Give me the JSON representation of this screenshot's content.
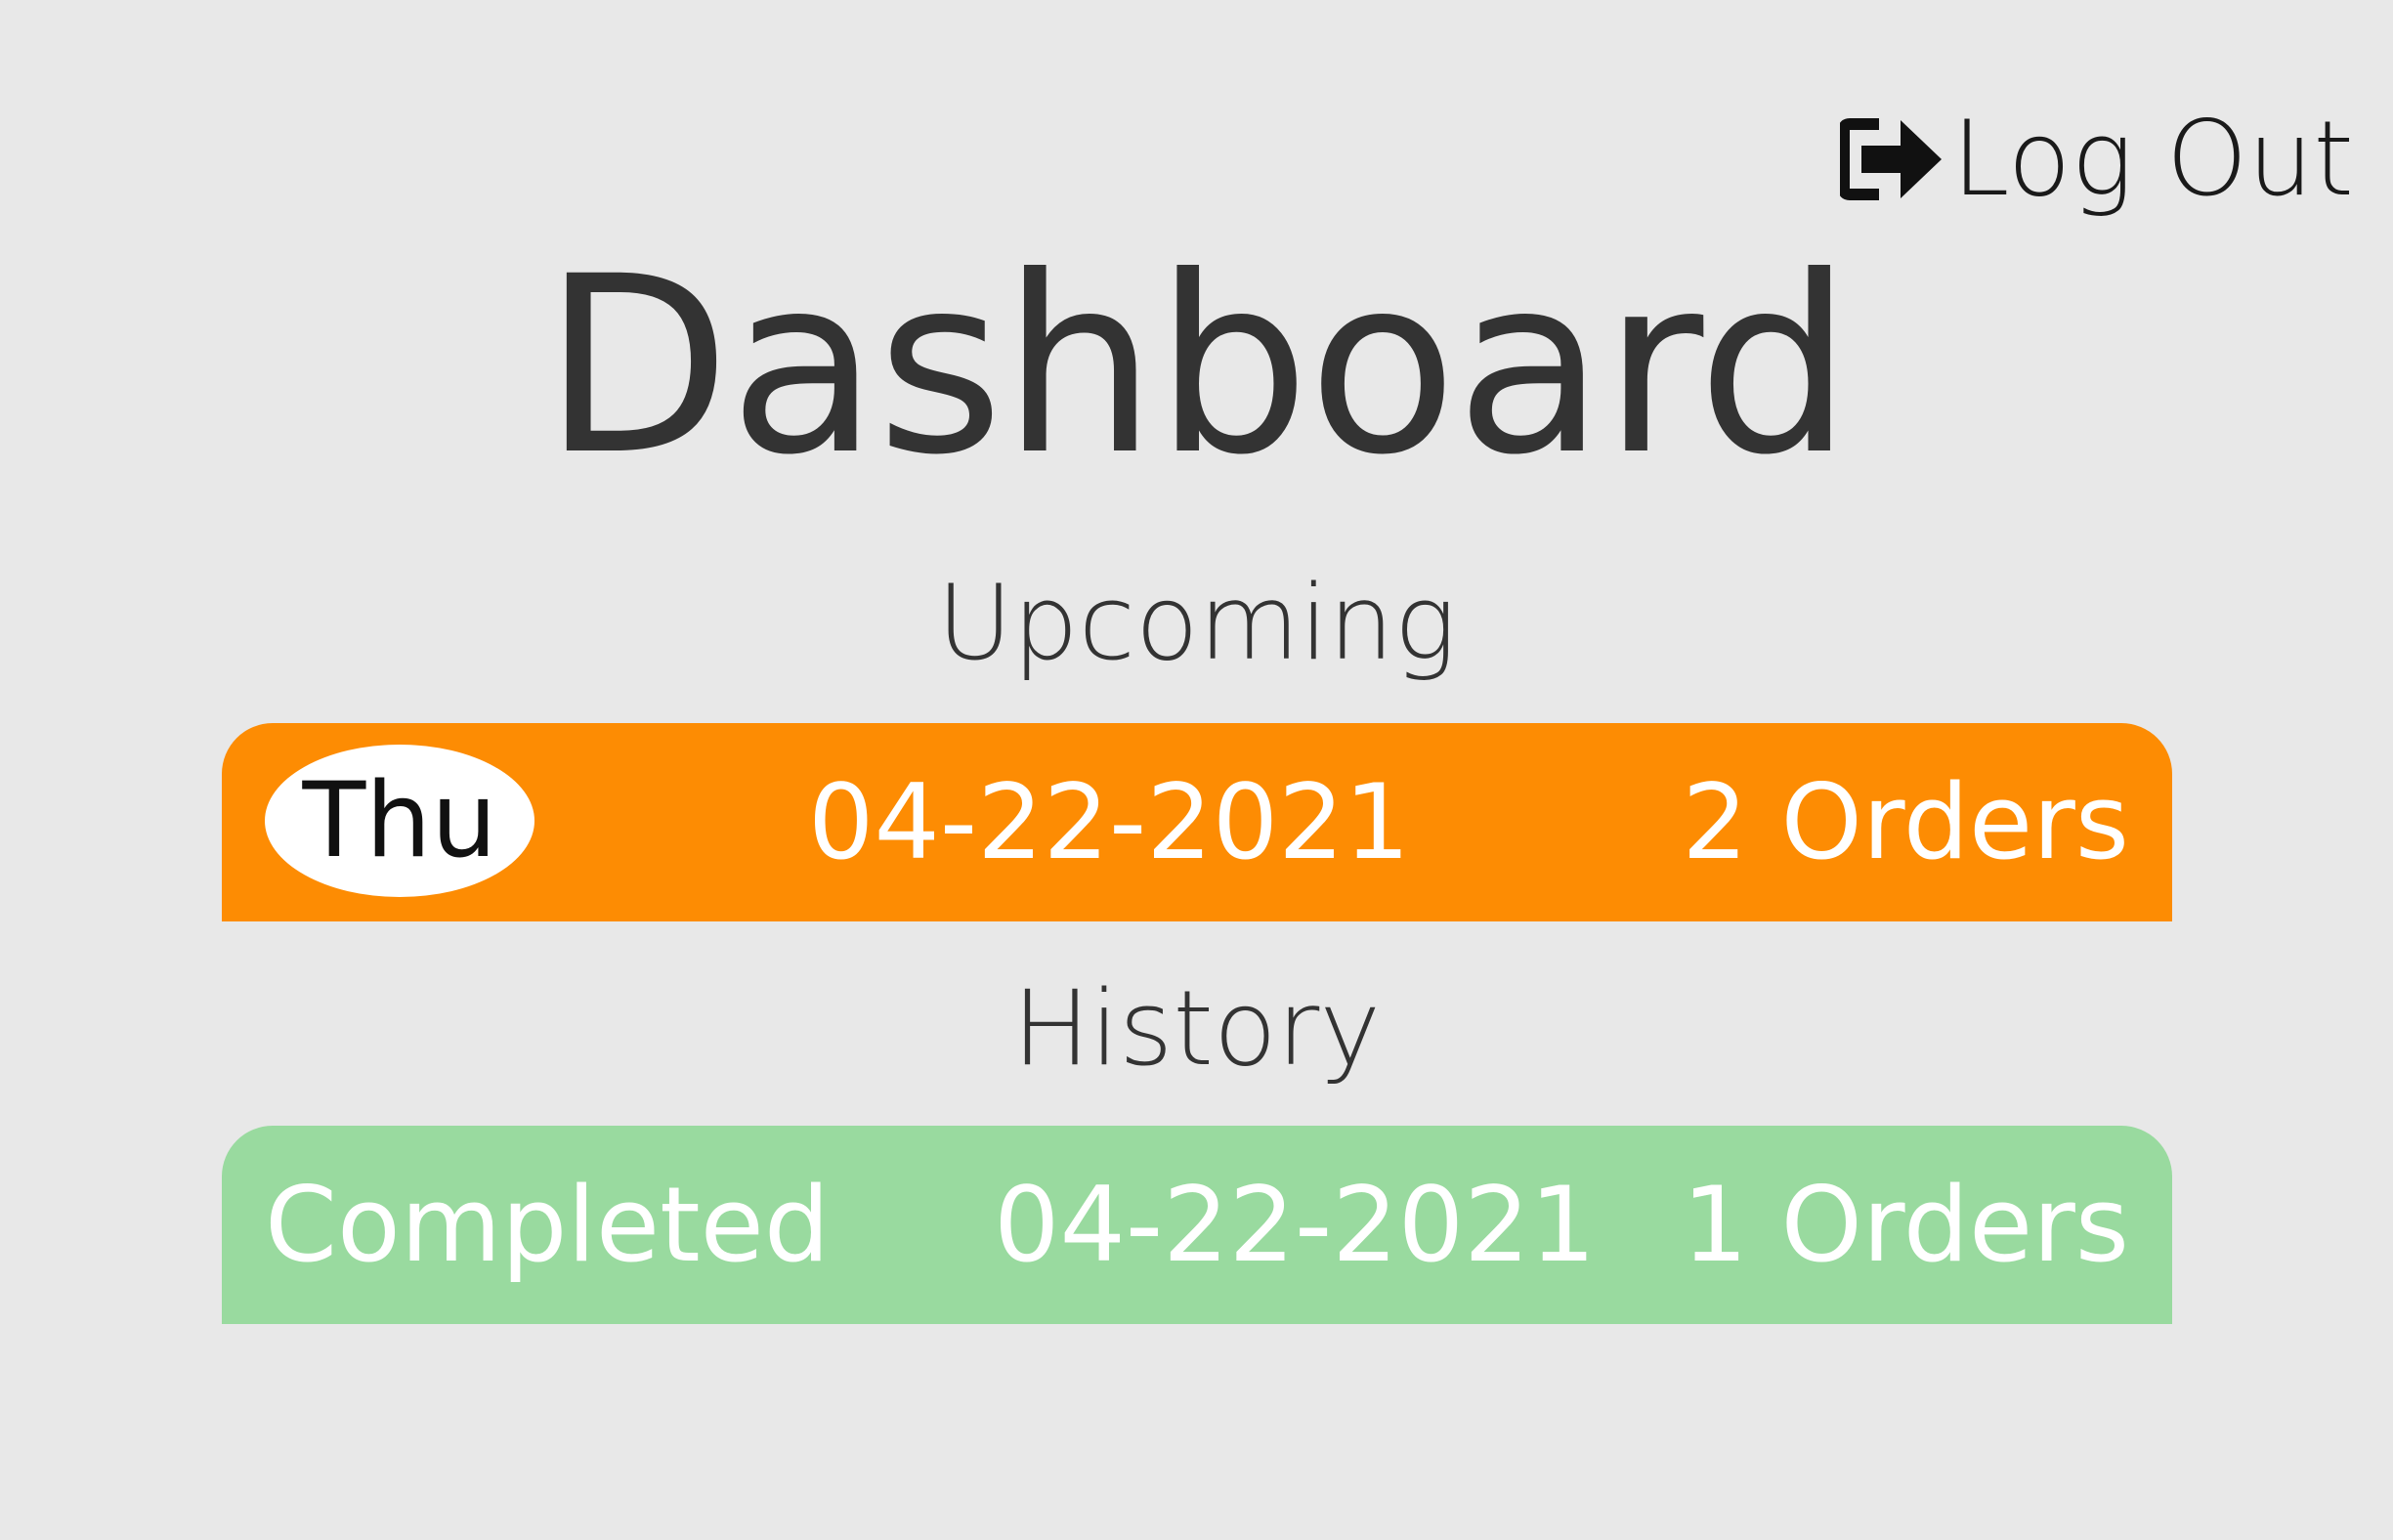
{
  "header": {
    "logout_label": "Log Out",
    "logout_icon": "sign-out-icon"
  },
  "page": {
    "title": "Dashboard"
  },
  "upcoming": {
    "heading": "Upcoming",
    "color": "#fd8c03",
    "rows": [
      {
        "day": "Thu",
        "date": "04-22-2021",
        "orders": "2 Orders"
      }
    ]
  },
  "history": {
    "heading": "History",
    "color": "#99da9f",
    "rows": [
      {
        "status": "Completed",
        "date": "04-22-2021",
        "orders": "1 Orders"
      }
    ]
  }
}
